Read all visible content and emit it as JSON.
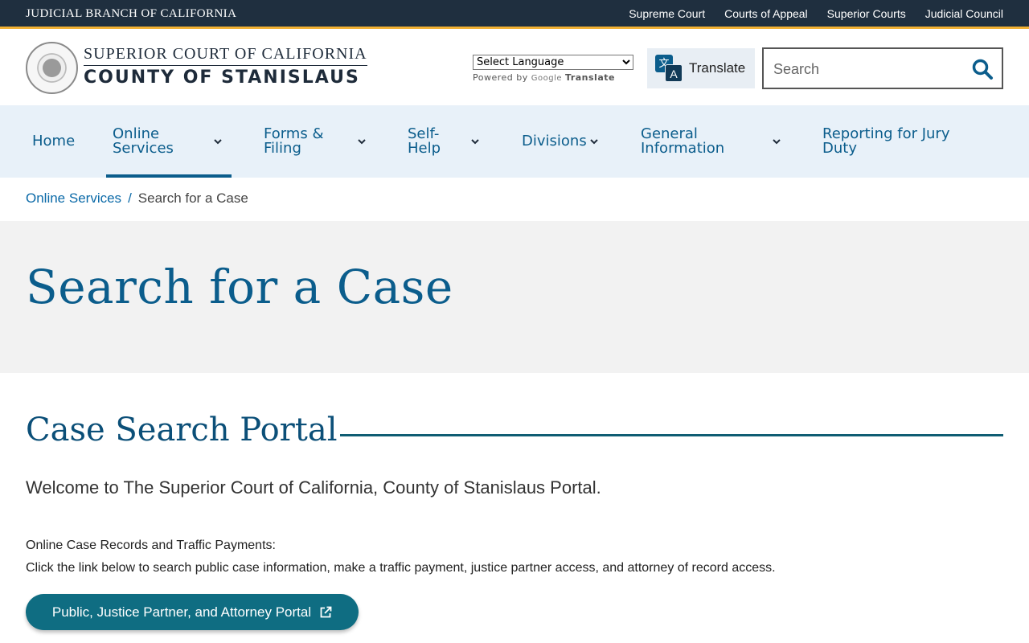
{
  "utility": {
    "brand": "JUDICIAL BRANCH OF CALIFORNIA",
    "links": [
      "Supreme Court",
      "Courts of Appeal",
      "Superior Courts",
      "Judicial Council"
    ]
  },
  "header": {
    "court_line1": "SUPERIOR COURT OF CALIFORNIA",
    "court_line2": "COUNTY OF STANISLAUS",
    "language_select": "Select Language",
    "powered_by": "Powered by",
    "google": "Google",
    "translate_word": "Translate",
    "translate_button": "Translate",
    "search_placeholder": "Search"
  },
  "nav": {
    "items": [
      {
        "label": "Home"
      },
      {
        "label": "Online Services"
      },
      {
        "label": "Forms & Filing"
      },
      {
        "label": "Self-Help"
      },
      {
        "label": "Divisions"
      },
      {
        "label": "General Information"
      },
      {
        "label": "Reporting for Jury Duty"
      }
    ]
  },
  "breadcrumb": {
    "parent": "Online Services",
    "separator": "/",
    "current": "Search for a Case"
  },
  "hero": {
    "title": "Search for a Case"
  },
  "content": {
    "section_title": "Case Search Portal",
    "welcome": "Welcome to The Superior Court of California, County of Stanislaus Portal.",
    "desc_line1": "Online Case Records and Traffic Payments:",
    "desc_line2": "Click the link below to search public case information, make a traffic payment, justice partner access, and attorney of record access.",
    "portal_button": "Public, Justice Partner, and Attorney Portal"
  },
  "colors": {
    "utility_bg": "#1f2f3f",
    "accent_gold": "#f2b134",
    "primary_blue": "#0b5d8c",
    "nav_bg": "#e8f1f9",
    "portal_button_bg": "#0f6d82"
  }
}
